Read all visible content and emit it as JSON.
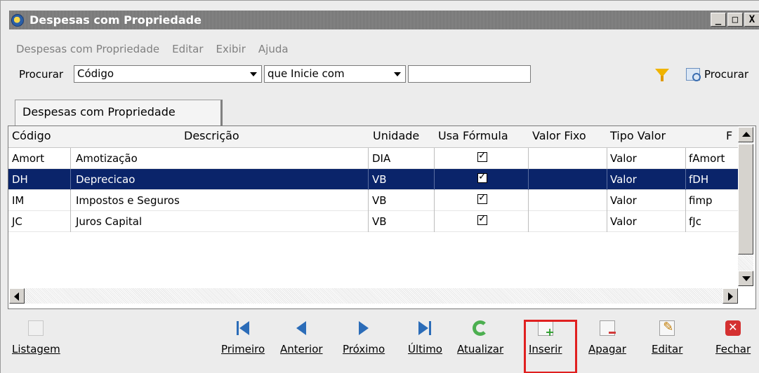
{
  "window": {
    "title": "Despesas com Propriedade",
    "controls": [
      "_",
      "□",
      "X"
    ]
  },
  "menu": [
    "Despesas com Propriedade",
    "Editar",
    "Exibir",
    "Ajuda"
  ],
  "search": {
    "label": "Procurar",
    "field_value": "Código",
    "mode_value": "que Inicie com",
    "input_value": "",
    "button_label": "Procurar"
  },
  "tab_label": "Despesas com Propriedade",
  "table": {
    "columns": [
      "Código",
      "Descrição",
      "Unidade",
      "Usa Fórmula",
      "Valor Fixo",
      "Tipo Valor",
      "F"
    ],
    "rows": [
      {
        "codigo": "Amort",
        "descricao": "Amotização",
        "unidade": "DIA",
        "usa_formula": true,
        "valor_fixo": "",
        "tipo_valor": "Valor",
        "formula": "fAmort"
      },
      {
        "codigo": "DH",
        "descricao": "Deprecicao",
        "unidade": "VB",
        "usa_formula": true,
        "valor_fixo": "",
        "tipo_valor": "Valor",
        "formula": "fDH"
      },
      {
        "codigo": "IM",
        "descricao": "Impostos e Seguros",
        "unidade": "VB",
        "usa_formula": true,
        "valor_fixo": "",
        "tipo_valor": "Valor",
        "formula": "fimp"
      },
      {
        "codigo": "JC",
        "descricao": "Juros Capital",
        "unidade": "VB",
        "usa_formula": true,
        "valor_fixo": "",
        "tipo_valor": "Valor",
        "formula": "fJc"
      }
    ],
    "selected_row": 1
  },
  "toolbar": {
    "listagem": "Listagem",
    "primeiro": "Primeiro",
    "anterior": "Anterior",
    "proximo": "Próximo",
    "ultimo": "Último",
    "atualizar": "Atualizar",
    "inserir": "Inserir",
    "apagar": "Apagar",
    "editar": "Editar",
    "fechar": "Fechar"
  },
  "colors": {
    "selection": "#0a246a",
    "highlight": "#e02020",
    "accent": "#2b6cb8"
  }
}
